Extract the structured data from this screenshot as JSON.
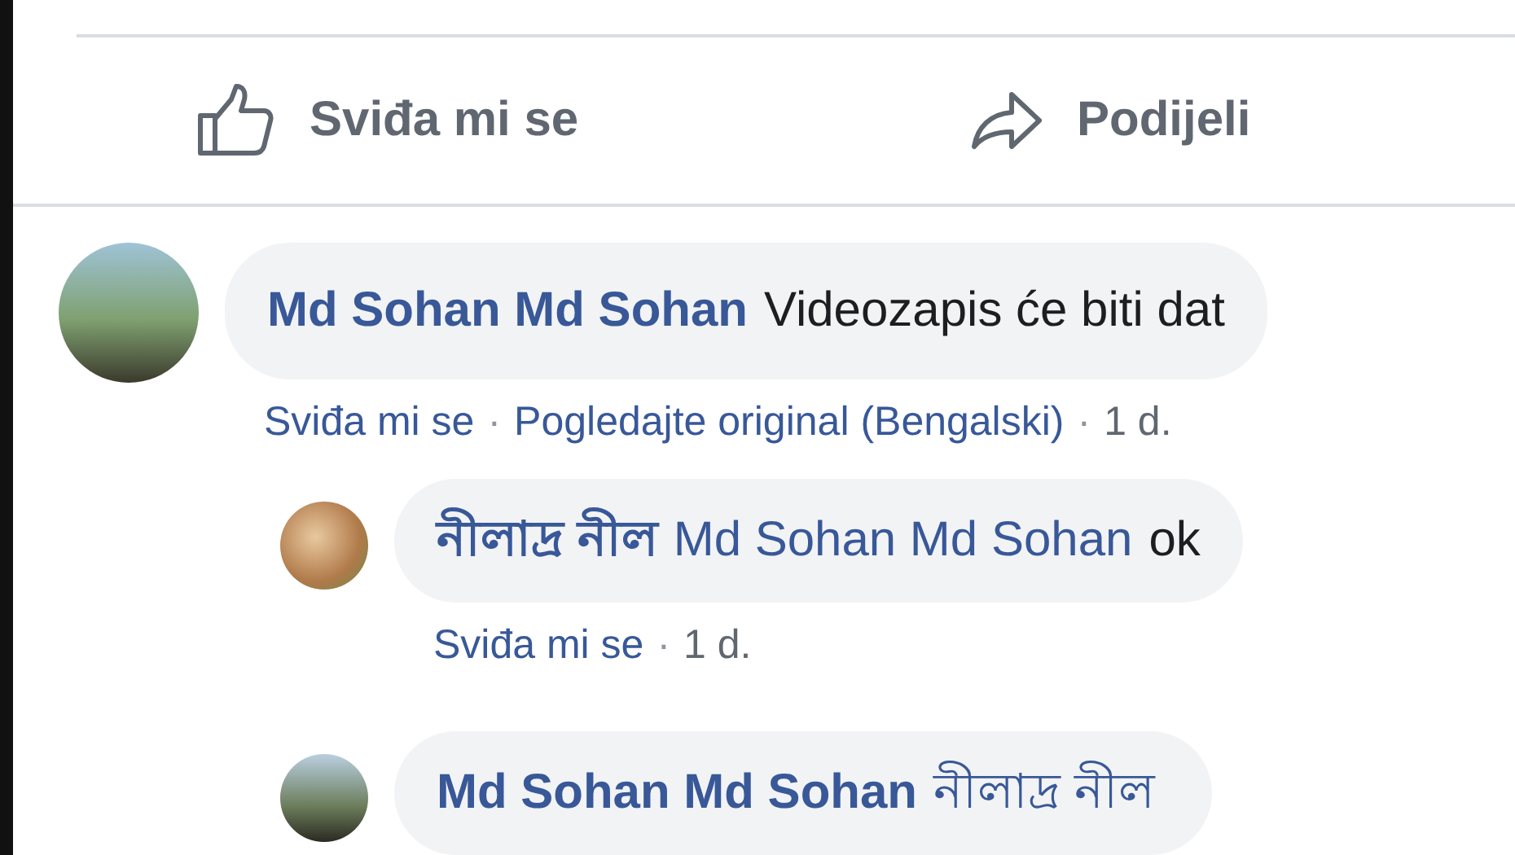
{
  "actions": [
    {
      "kind": "like",
      "label": "Sviđa mi se"
    },
    {
      "kind": "share",
      "label": "Podijeli"
    }
  ],
  "comments": [
    {
      "author": "Md Sohan Md Sohan",
      "text": "Videozapis će biti dat",
      "meta": [
        {
          "kind": "link",
          "label": "Sviđa mi se"
        },
        {
          "kind": "dot",
          "label": "·"
        },
        {
          "kind": "link",
          "label": "Pogledajte original (Bengalski)"
        },
        {
          "kind": "dot",
          "label": "·"
        },
        {
          "kind": "time",
          "label": "1 d."
        }
      ],
      "children": [
        {
          "author": "নীলাদ্র নীল",
          "mention": "Md Sohan Md Sohan",
          "text": "ok",
          "meta": [
            {
              "kind": "link",
              "label": "Sviđa mi se"
            },
            {
              "kind": "dot",
              "label": "·"
            },
            {
              "kind": "time",
              "label": "1 d."
            }
          ]
        },
        {
          "author": "Md Sohan Md Sohan",
          "mention": "নীলাদ্র নীল"
        }
      ]
    }
  ]
}
